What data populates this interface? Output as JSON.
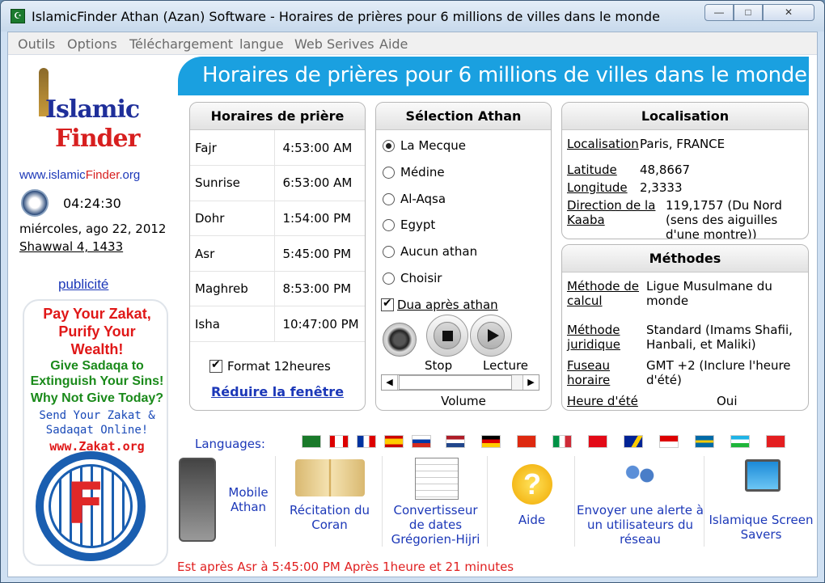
{
  "window": {
    "title": "IslamicFinder Athan (Azan) Software - Horaires de prières pour 6 millions de villes dans le monde",
    "controls": {
      "minimize": "—",
      "maximize": "□",
      "close": "✕"
    }
  },
  "menu": [
    "Outils",
    "Options",
    "Téléchargement",
    "langue",
    "Web Serives",
    "Aide"
  ],
  "left": {
    "logo_top": "Islamic",
    "logo_bottom": "Finder",
    "site_prefix": "www.islamic",
    "site_mid": "Finder",
    "site_suffix": ".org",
    "time": "04:24:30",
    "date": "miércoles, ago 22, 2012",
    "hijri": "Shawwal 4, 1433",
    "ad_link": "publicité",
    "zakat": {
      "line1": "Pay Your Zakat,",
      "line2": "Purify Your",
      "line3": "Wealth!",
      "line4": "Give Sadaqa to",
      "line5": "Extinguish Your Sins!",
      "line6": "Why Not Give Today?",
      "line7": "Send Your Zakat &",
      "line8": "Sadaqat Online!",
      "line9": "www.Zakat.org"
    }
  },
  "header": {
    "title": "Horaires de prières pour 6 millions de villes dans le monde"
  },
  "prayer": {
    "heading": "Horaires de prière",
    "rows": [
      {
        "name": "Fajr",
        "time": "4:53:00 AM"
      },
      {
        "name": "Sunrise",
        "time": "6:53:00 AM"
      },
      {
        "name": "Dohr",
        "time": "1:54:00 PM"
      },
      {
        "name": "Asr",
        "time": "5:45:00 PM"
      },
      {
        "name": "Maghreb",
        "time": "8:53:00 PM"
      },
      {
        "name": "Isha",
        "time": "10:47:00 PM"
      }
    ],
    "format_label": "Format 12heures",
    "format_checked": true,
    "reduce_link": "Réduire la fenêtre"
  },
  "athan": {
    "heading": "Sélection Athan",
    "options": [
      "La Mecque",
      "Médine",
      "Al-Aqsa",
      "Egypt",
      "Aucun athan",
      "Choisir"
    ],
    "selected_index": 0,
    "dua_label": "Dua après athan",
    "dua_checked": true,
    "stop_label": "Stop",
    "play_label": "Lecture",
    "volume_label": "Volume",
    "volume_level": 0.05
  },
  "location": {
    "heading": "Localisation",
    "localisation_key": "Localisation",
    "localisation_val": "Paris, FRANCE",
    "latitude_key": "Latitude",
    "latitude_val": "48,8667",
    "longitude_key": "Longitude",
    "longitude_val": "2,3333",
    "kaaba_key": "Direction de la Kaaba",
    "kaaba_val": "119,1757 (Du Nord (sens des aiguilles d'une montre))"
  },
  "methods": {
    "heading": "Méthodes",
    "calc_key": "Méthode de calcul",
    "calc_val": "Ligue Musulmane du monde",
    "jur_key": "Méthode juridique",
    "jur_val": "Standard (Imams Shafii, Hanbali, et Maliki)",
    "tz_key": "Fuseau horaire",
    "tz_val": "GMT +2 (Inclure l'heure d'été)",
    "dst_key": "Heure d'été",
    "dst_val": "Oui"
  },
  "bottom": {
    "languages_label": "Languages:",
    "flags": [
      "saudi-arabia",
      "canada",
      "france",
      "spain",
      "russia",
      "netherlands",
      "germany",
      "china",
      "italy",
      "turkey",
      "bosnia",
      "indonesia",
      "sweden",
      "uzbekistan",
      "albania"
    ],
    "tools": {
      "mobile": "Mobile Athan",
      "quran": "Récitation du Coran",
      "converter": "Convertisseur de dates Grégorien-Hijri",
      "help": "Aide",
      "alert": "Envoyer une alerte à un utilisateurs du réseau",
      "screensaver": "Islamique Screen Savers"
    },
    "status": "Est après Asr à 5:45:00 PM Après 1heure et 21 minutes"
  },
  "colors": {
    "banner": "#1aa0e0",
    "link": "#1c38b8",
    "status": "#e02020"
  }
}
